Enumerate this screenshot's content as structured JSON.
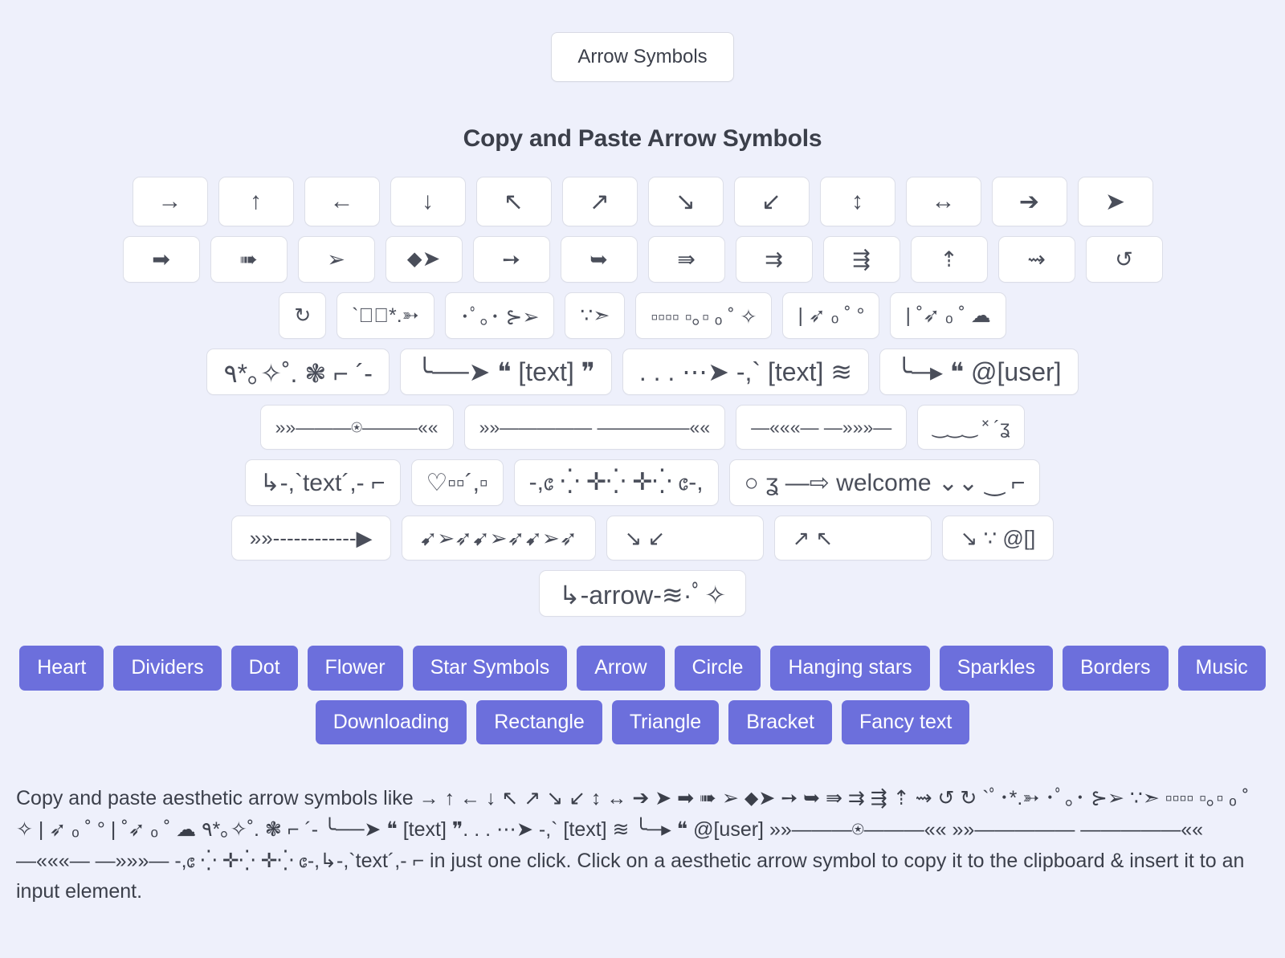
{
  "top_pill": {
    "label": "Arrow Symbols"
  },
  "heading": "Copy and Paste Arrow Symbols",
  "symbol_rows": [
    {
      "row": 1,
      "cells": [
        "→",
        "↑",
        "←",
        "↓",
        "↖",
        "↗",
        "↘",
        "↙",
        "↕",
        "↔",
        "➔",
        "➤"
      ]
    },
    {
      "row": 2,
      "cells": [
        "➡",
        "➠",
        "➢",
        "⬥➤",
        "➙",
        "➥",
        "⇛",
        "⇉",
        "⇶",
        "⇡",
        "⇝",
        "↺"
      ]
    },
    {
      "row": 3,
      "cells": [
        "↻",
        "`ﾟ･*.➳",
        "･ﾟ｡･ ⊱➢",
        "∵➣",
        "▫▫▫▫ ▫｡▫ ₒ ˚ ✧",
        "| ➶ ₒ ˚ °",
        "| ˚➶ ₒ ˚ ☁"
      ]
    },
    {
      "row": 4,
      "cells": [
        "٩*｡✧˚. ❃ ⌐ ´-",
        "╰──➤ ❝ [text] ❞",
        ". . . ⋯➤ -,` [text] ≋",
        "╰─▸ ❝ @[user]"
      ]
    },
    {
      "row": 5,
      "cells": [
        "»»———⍟———««",
        "»»—————  —————««",
        "—«««—          —»»»—",
        "‿‿‿ ˟ ´ʓ"
      ]
    },
    {
      "row": 6,
      "cells": [
        "↳-,`text´,- ⌐",
        "♡▫▫´,▫",
        "-,᥋  ⁛ ✛⁛ ✛⁛  ᥋-,",
        "○ ʓ —⇨ welcome ⌄⌄ ‿ ⌐"
      ]
    },
    {
      "row": 7,
      "cells": [
        "»»------------▶",
        "➹➢➶➹➢➶➹➢➶",
        "↘        ↙",
        "↗        ↖",
        "↘ ∵ @[]"
      ]
    },
    {
      "row": 8,
      "cells": [
        "↳-arrow-≋·ﾟ✧"
      ]
    }
  ],
  "tags": {
    "row1": [
      "Heart",
      "Dividers",
      "Dot",
      "Flower",
      "Star Symbols",
      "Arrow",
      "Circle",
      "Hanging stars",
      "Sparkles",
      "Borders",
      "Music"
    ],
    "row2": [
      "Downloading",
      "Rectangle",
      "Triangle",
      "Bracket",
      "Fancy text"
    ]
  },
  "description": "Copy and paste aesthetic arrow symbols like → ↑ ← ↓ ↖ ↗ ↘ ↙ ↕ ↔ ➔ ➤ ➡ ➠ ➢ ⬥➤ ➙ ➥ ⇛ ⇉ ⇶ ⇡ ⇝ ↺ ↻ `ﾟ･*.➳ ･ﾟ｡･ ⊱➢ ∵➣ ▫▫▫▫ ▫｡▫ ₒ ˚ ✧ | ➶ ₒ ˚ ° | ˚➶ ₒ ˚ ☁ ٩*｡✧˚. ❃ ⌐ ´- ╰──➤ ❝ [text] ❞. . . ⋯➤ -,` [text] ≋ ╰─▸ ❝ @[user] »»———⍟———«« »»—————  —————«« —«««— —»»»— -,᥋  ⁛ ✛⁛ ✛⁛  ᥋-,↳-,`text´,- ⌐ in just one click. Click on a aesthetic arrow symbol to copy it to the clipboard & insert it to an input element."
}
